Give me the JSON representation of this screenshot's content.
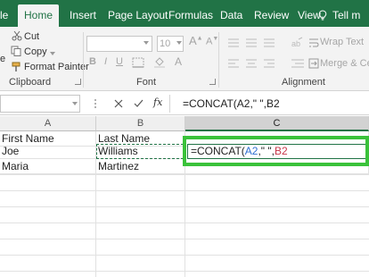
{
  "tabs": [
    {
      "label": "le"
    },
    {
      "label": "Home",
      "active": true
    },
    {
      "label": "Insert"
    },
    {
      "label": "Page Layout"
    },
    {
      "label": "Formulas"
    },
    {
      "label": "Data"
    },
    {
      "label": "Review"
    },
    {
      "label": "View"
    },
    {
      "label": "Tell m"
    }
  ],
  "ribbon": {
    "clipboard": {
      "cut_label": "Cut",
      "copy_label": "Copy",
      "format_painter_label": "Format Painter",
      "paste_label": "e",
      "group_label": "Clipboard"
    },
    "font": {
      "font_size": "10",
      "group_label": "Font"
    },
    "alignment": {
      "wrap_text_label": "Wrap Text",
      "merge_label": "Merge & Cent",
      "group_label": "Alignment"
    }
  },
  "formula_bar": {
    "fx_label": "fx",
    "formula": "=CONCAT(A2,\" \",B2"
  },
  "columns": [
    {
      "label": "A"
    },
    {
      "label": "B"
    },
    {
      "label": "C"
    }
  ],
  "rows": [
    {
      "a": "First Name",
      "b": "Last Name"
    },
    {
      "a": "Joe",
      "b": "Williams"
    },
    {
      "a": "Maria",
      "b": "Martinez"
    }
  ],
  "editing_cell": {
    "prefix": "=CONCAT(",
    "ref1": "A2",
    "middle": ",\" \",",
    "ref2": "B2"
  },
  "colors": {
    "accent": "#217346",
    "highlight_frame": "#3ac23a",
    "ref_blue": "#2e6fd1",
    "ref_red": "#c8384b"
  }
}
